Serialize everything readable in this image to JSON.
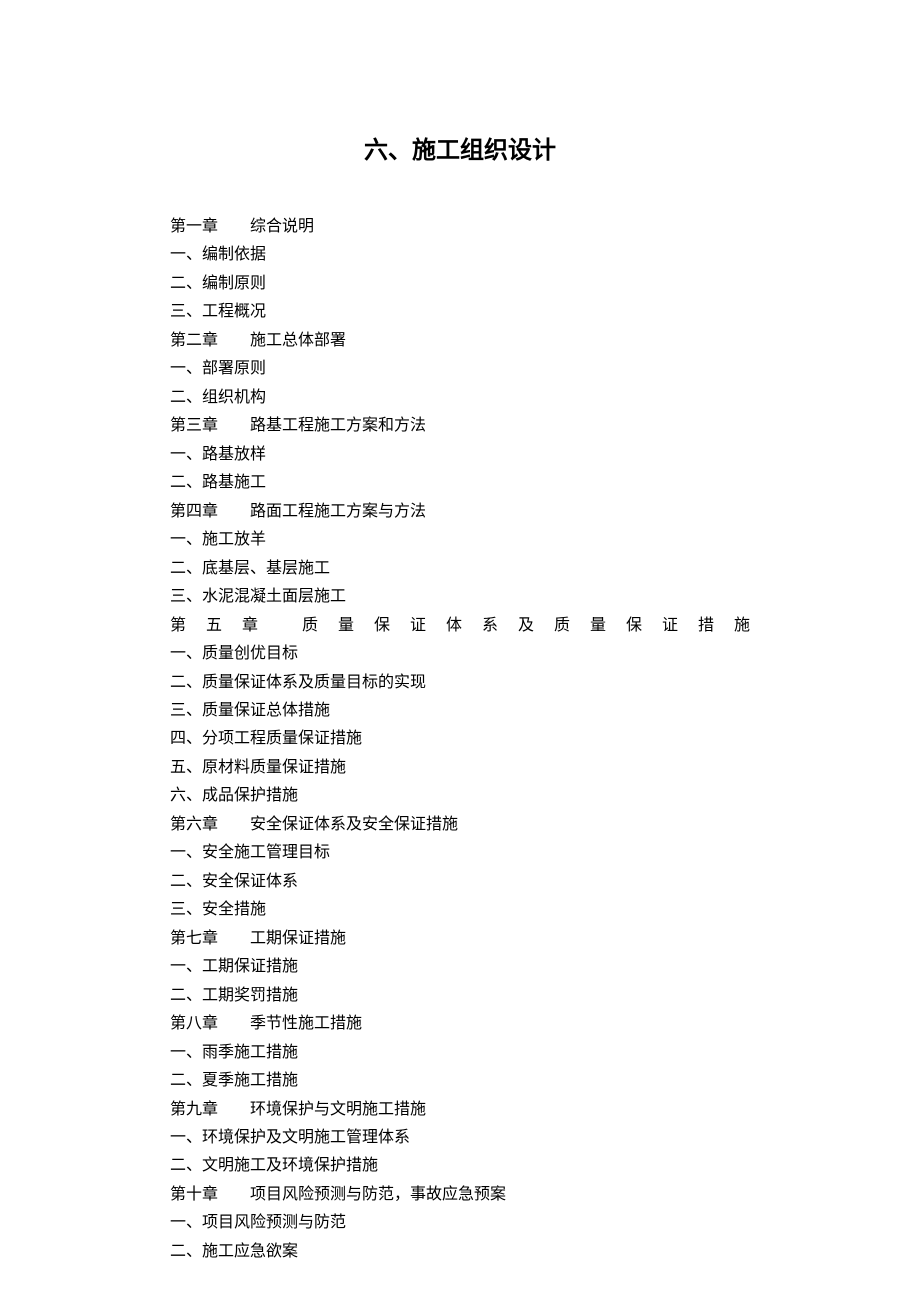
{
  "title": "六、施工组织设计",
  "toc": {
    "ch1": {
      "label": "第一章",
      "title": "综合说明"
    },
    "ch1_1": "一、编制依据",
    "ch1_2": "二、编制原则",
    "ch1_3": "三、工程概况",
    "ch2": {
      "label": "第二章",
      "title": "施工总体部署"
    },
    "ch2_1": "一、部署原则",
    "ch2_2": "二、组织机构",
    "ch3": {
      "label": "第三章",
      "title": "路基工程施工方案和方法"
    },
    "ch3_1": "一、路基放样",
    "ch3_2": "二、路基施工",
    "ch4": {
      "label": "第四章",
      "title": "路面工程施工方案与方法"
    },
    "ch4_1": "一、施工放羊",
    "ch4_2": "二、底基层、基层施工",
    "ch4_3": "三、水泥混凝土面层施工",
    "ch5j": "第五章 质量保证体系及质量保证措施",
    "ch5_1": "一、质量创优目标",
    "ch5_2": "二、质量保证体系及质量目标的实现",
    "ch5_3": "三、质量保证总体措施",
    "ch5_4": "四、分项工程质量保证措施",
    "ch5_5": "五、原材料质量保证措施",
    "ch5_6": "六、成品保护措施",
    "ch6": {
      "label": "第六章",
      "title": "安全保证体系及安全保证措施"
    },
    "ch6_1": "一、安全施工管理目标",
    "ch6_2": "二、安全保证体系",
    "ch6_3": "三、安全措施",
    "ch7": {
      "label": "第七章",
      "title": "工期保证措施"
    },
    "ch7_1": "一、工期保证措施",
    "ch7_2": "二、工期奖罚措施",
    "ch8": {
      "label": "第八章",
      "title": "季节性施工措施"
    },
    "ch8_1": "一、雨季施工措施",
    "ch8_2": "二、夏季施工措施",
    "ch9": {
      "label": "第九章",
      "title": "环境保护与文明施工措施"
    },
    "ch9_1": "一、环境保护及文明施工管理体系",
    "ch9_2": "二、文明施工及环境保护措施",
    "ch10": {
      "label": "第十章",
      "title": "项目风险预测与防范，事故应急预案"
    },
    "ch10_1": "一、项目风险预测与防范",
    "ch10_2": "二、施工应急欲案"
  }
}
